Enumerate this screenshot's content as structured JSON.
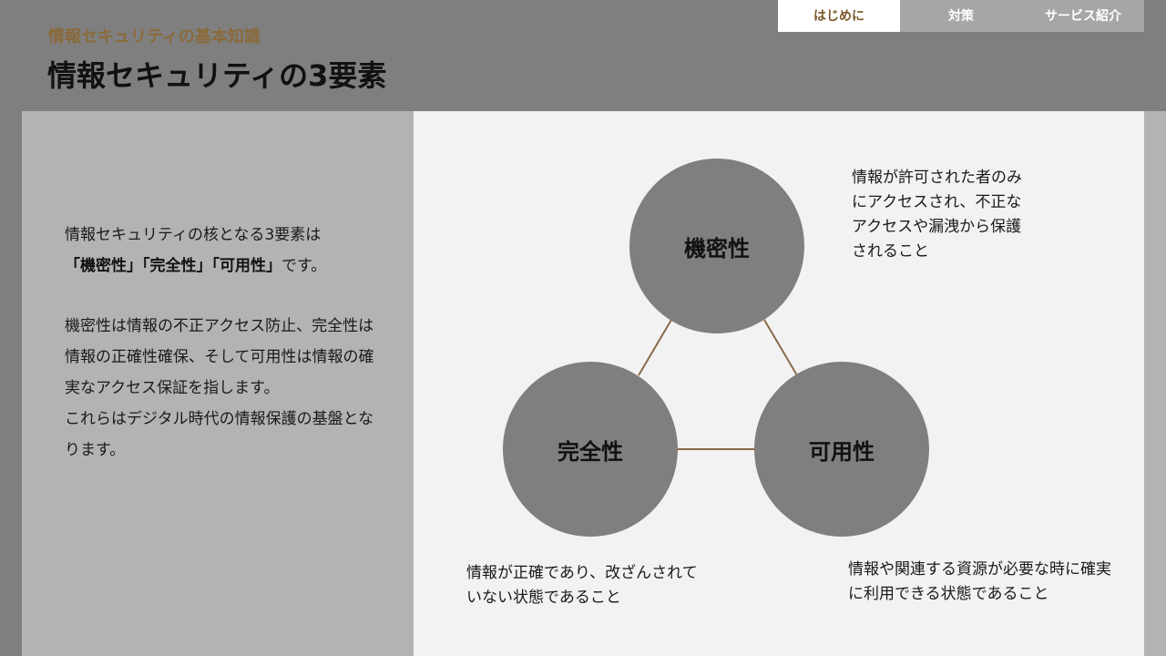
{
  "header": {
    "subtitle": "情報セキュリティの基本知識",
    "title": "情報セキュリティの3要素"
  },
  "tabs": [
    {
      "label": "はじめに",
      "active": true
    },
    {
      "label": "対策",
      "active": false
    },
    {
      "label": "サービス紹介",
      "active": false
    }
  ],
  "intro": {
    "line1": "情報セキュリティの核となる3要素は",
    "q_open": "「",
    "term1": "機密性",
    "q_mid1": "」「",
    "term2": "完全性",
    "q_mid2": "」「",
    "term3": "可用性",
    "q_close": "」",
    "line2_tail": "です。",
    "para2": "機密性は情報の不正アクセス防止、完全性は情報の正確性確保、そして可用性は情報の確実なアクセス保証を指します。",
    "para3": "これらはデジタル時代の情報保護の基盤となります。"
  },
  "elements": {
    "confidentiality": {
      "label": "機密性",
      "description": "情報が許可された者のみにアクセスされ、不正なアクセスや漏洩から保護されること"
    },
    "integrity": {
      "label": "完全性",
      "description": "情報が正確であり、改ざんされていない状態であること"
    },
    "availability": {
      "label": "可用性",
      "description": "情報や関連する資源が必要な時に確実に利用できる状態であること"
    }
  },
  "colors": {
    "accent": "#8a6a3a",
    "circle": "#7f7f7f",
    "connector": "#8a6a4a"
  }
}
